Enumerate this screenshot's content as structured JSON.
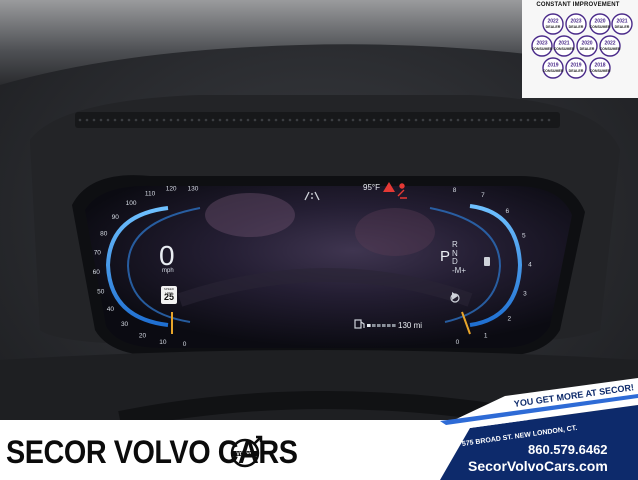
{
  "badges": {
    "header": "CONSTANT IMPROVEMENT",
    "items": [
      {
        "year": "2022",
        "label": "DEALER"
      },
      {
        "year": "2023",
        "label": "DEALER"
      },
      {
        "year": "2020",
        "label": "CONSUMER"
      },
      {
        "year": "2021",
        "label": "DEALER"
      },
      {
        "year": "2023",
        "label": "CONSUMER"
      },
      {
        "year": "2021",
        "label": "CONSUMER"
      },
      {
        "year": "2020",
        "label": "DEALER"
      },
      {
        "year": "2022",
        "label": "CONSUMER"
      },
      {
        "year": "2019",
        "label": "CONSUMER"
      },
      {
        "year": "2019",
        "label": "DEALER"
      },
      {
        "year": "2018",
        "label": "CONSUMER"
      }
    ]
  },
  "cluster": {
    "speedometer_ticks": [
      "0",
      "10",
      "20",
      "30",
      "40",
      "50",
      "60",
      "70",
      "80",
      "90",
      "100",
      "110",
      "120",
      "130"
    ],
    "speed_value": "0",
    "speed_unit": "mph",
    "speed_limit_label": "SPEED LIMIT",
    "speed_limit_value": "25",
    "outside_temp": "95°F",
    "tach_ticks": [
      "0",
      "1",
      "2",
      "3",
      "4",
      "5",
      "6",
      "7",
      "8"
    ],
    "gear_selected": "P",
    "gear_options": [
      "R",
      "N",
      "D",
      "-M+"
    ],
    "range": "130 mi",
    "colors": {
      "accent": "#3a9be8",
      "needle": "#e8a52a",
      "warning": "#e53935"
    }
  },
  "banner": {
    "brand": "SECOR VOLVO CARS",
    "logo_text": "VOLVO",
    "tagline": "YOU GET MORE AT SECOR!",
    "address": "575 BROAD ST. NEW LONDON, CT.",
    "phone": "860.579.6462",
    "website": "SecorVolvoCars.com",
    "colors": {
      "navy": "#0d2a6b",
      "white": "#ffffff"
    }
  }
}
